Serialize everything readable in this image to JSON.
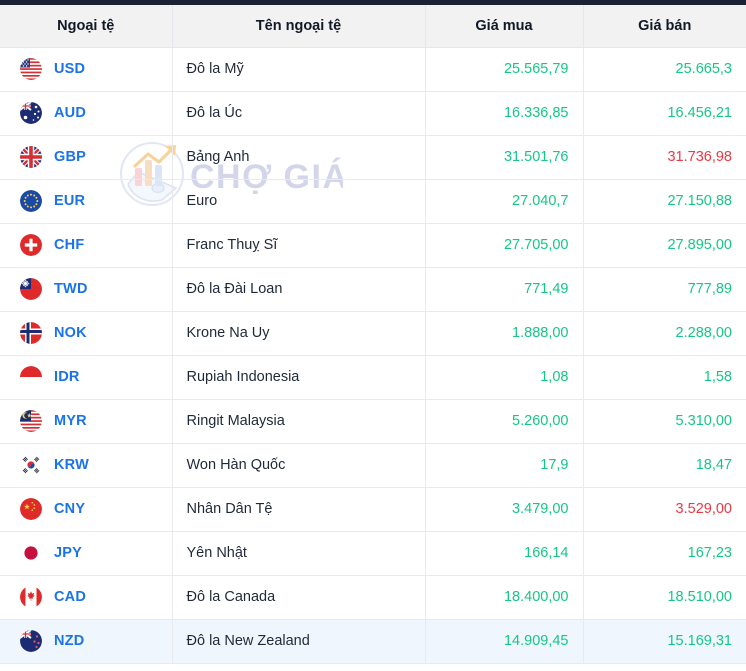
{
  "table": {
    "columns": [
      {
        "key": "currency",
        "label": "Ngoại tệ"
      },
      {
        "key": "name",
        "label": "Tên ngoại tệ"
      },
      {
        "key": "buy",
        "label": "Giá mua"
      },
      {
        "key": "sell",
        "label": "Giá bán"
      }
    ],
    "rows": [
      {
        "code": "USD",
        "flag": "flag-us-icon",
        "name": "Đô la Mỹ",
        "buy": "25.565,79",
        "sell": "25.665,3",
        "buy_dir": "up",
        "sell_dir": "up",
        "highlighted": false
      },
      {
        "code": "AUD",
        "flag": "flag-au-icon",
        "name": "Đô la Úc",
        "buy": "16.336,85",
        "sell": "16.456,21",
        "buy_dir": "up",
        "sell_dir": "up",
        "highlighted": false
      },
      {
        "code": "GBP",
        "flag": "flag-gb-icon",
        "name": "Bảng Anh",
        "buy": "31.501,76",
        "sell": "31.736,98",
        "buy_dir": "up",
        "sell_dir": "down",
        "highlighted": false
      },
      {
        "code": "EUR",
        "flag": "flag-eu-icon",
        "name": "Euro",
        "buy": "27.040,7",
        "sell": "27.150,88",
        "buy_dir": "up",
        "sell_dir": "up",
        "highlighted": false
      },
      {
        "code": "CHF",
        "flag": "flag-ch-icon",
        "name": "Franc Thuỵ Sĩ",
        "buy": "27.705,00",
        "sell": "27.895,00",
        "buy_dir": "up",
        "sell_dir": "up",
        "highlighted": false
      },
      {
        "code": "TWD",
        "flag": "flag-tw-icon",
        "name": "Đô la Đài Loan",
        "buy": "771,49",
        "sell": "777,89",
        "buy_dir": "up",
        "sell_dir": "up",
        "highlighted": false
      },
      {
        "code": "NOK",
        "flag": "flag-no-icon",
        "name": "Krone Na Uy",
        "buy": "1.888,00",
        "sell": "2.288,00",
        "buy_dir": "up",
        "sell_dir": "up",
        "highlighted": false
      },
      {
        "code": "IDR",
        "flag": "flag-id-icon",
        "name": "Rupiah Indonesia",
        "buy": "1,08",
        "sell": "1,58",
        "buy_dir": "up",
        "sell_dir": "up",
        "highlighted": false
      },
      {
        "code": "MYR",
        "flag": "flag-my-icon",
        "name": "Ringit Malaysia",
        "buy": "5.260,00",
        "sell": "5.310,00",
        "buy_dir": "up",
        "sell_dir": "up",
        "highlighted": false
      },
      {
        "code": "KRW",
        "flag": "flag-kr-icon",
        "name": "Won Hàn Quốc",
        "buy": "17,9",
        "sell": "18,47",
        "buy_dir": "up",
        "sell_dir": "up",
        "highlighted": false
      },
      {
        "code": "CNY",
        "flag": "flag-cn-icon",
        "name": "Nhân Dân Tệ",
        "buy": "3.479,00",
        "sell": "3.529,00",
        "buy_dir": "up",
        "sell_dir": "down",
        "highlighted": false
      },
      {
        "code": "JPY",
        "flag": "flag-jp-icon",
        "name": "Yên Nhật",
        "buy": "166,14",
        "sell": "167,23",
        "buy_dir": "up",
        "sell_dir": "up",
        "highlighted": false
      },
      {
        "code": "CAD",
        "flag": "flag-ca-icon",
        "name": "Đô la Canada",
        "buy": "18.400,00",
        "sell": "18.510,00",
        "buy_dir": "up",
        "sell_dir": "up",
        "highlighted": false
      },
      {
        "code": "NZD",
        "flag": "flag-nz-icon",
        "name": "Đô la New Zealand",
        "buy": "14.909,45",
        "sell": "15.169,31",
        "buy_dir": "up",
        "sell_dir": "up",
        "highlighted": true
      }
    ]
  },
  "watermark": {
    "text": "CHỢ GIÁ",
    "icon": "chart-wallet-logo-icon"
  },
  "colors": {
    "up": "#16c784",
    "down": "#ea3943",
    "code": "#1a73e8",
    "header_bg": "#f2f2f2",
    "highlight_row": "#eff6fd",
    "topbar": "#1b2233"
  }
}
